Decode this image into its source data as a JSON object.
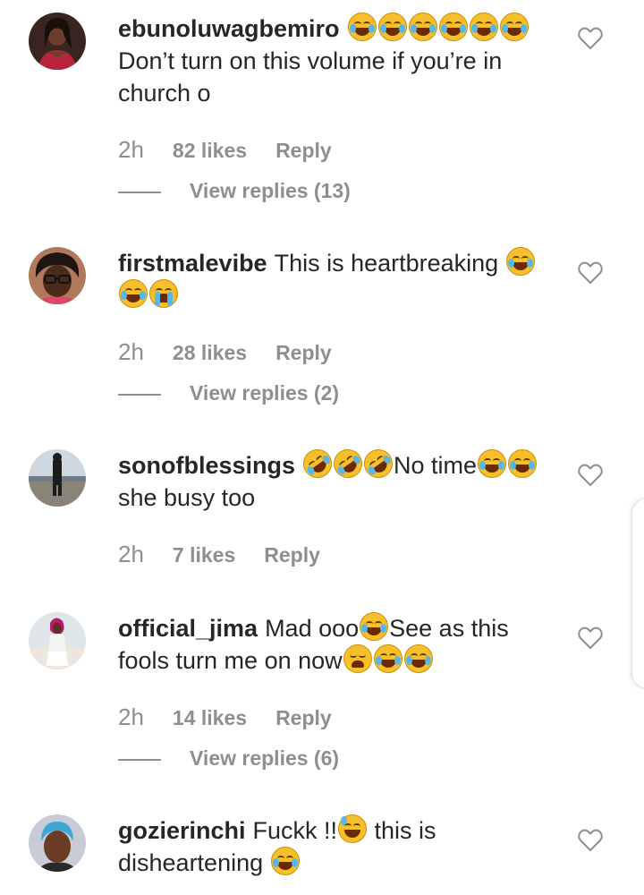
{
  "comments": [
    {
      "username": "ebunoluwagbemiro",
      "text_line1": "Don’t turn on this volume if you’re in",
      "text_line2": "church o",
      "time": "2h",
      "likes": "82 likes",
      "reply": "Reply",
      "view_replies": "View replies (13)"
    },
    {
      "username": "firstmalevibe",
      "text_part1": "This is heartbreaking",
      "time": "2h",
      "likes": "28 likes",
      "reply": "Reply",
      "view_replies": "View replies (2)"
    },
    {
      "username": "sonofblessings",
      "text_part1": "No time",
      "text_line2": "she busy too",
      "time": "2h",
      "likes": "7 likes",
      "reply": "Reply"
    },
    {
      "username": "official_jima",
      "text_part1": "Mad ooo",
      "text_part2": "See as this",
      "text_line2": "fools turn me on now",
      "time": "2h",
      "likes": "14 likes",
      "reply": "Reply",
      "view_replies": "View replies (6)"
    },
    {
      "username": "gozierinchi",
      "text_part1": "Fuckk !!",
      "text_part2": " this is",
      "text_line2": "disheartening"
    }
  ],
  "icons": {
    "heart": "heart-outline-icon",
    "laugh": "face-with-tears-of-joy",
    "rofl": "rolling-on-floor-laughing",
    "cry": "loudly-crying-face",
    "weary": "weary-face",
    "sweat": "grinning-face-with-sweat"
  },
  "colors": {
    "text": "#262626",
    "secondary": "#8e8e8e",
    "emoji": "#f7c02a"
  }
}
